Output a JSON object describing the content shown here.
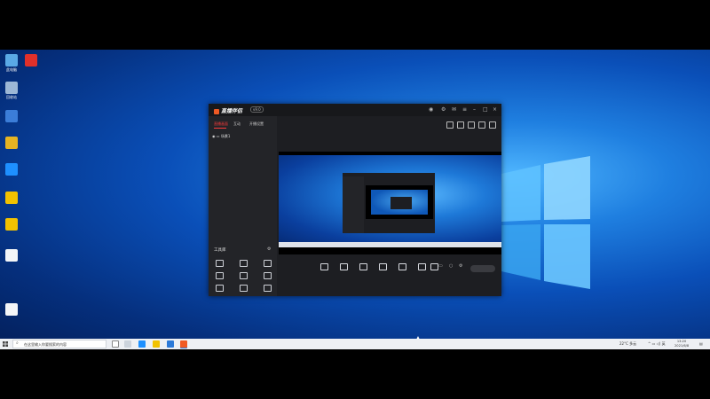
{
  "desktop": {
    "icons": [
      {
        "label": "此电脑",
        "color": "#5aa9e6"
      },
      {
        "label": "",
        "color": "#e0302a"
      },
      {
        "label": "回收站",
        "color": "#9db8d6"
      },
      {
        "label": "",
        "color": "#3b7dd8"
      },
      {
        "label": "",
        "color": "#e6b422"
      },
      {
        "label": "",
        "color": "#1e90ff"
      },
      {
        "label": "",
        "color": "#f2c200"
      },
      {
        "label": "",
        "color": "#f2c200"
      },
      {
        "label": "",
        "color": "#f4f6f8"
      },
      {
        "label": "",
        "color": "#f4f6f8"
      }
    ]
  },
  "app": {
    "brand": "直播伴侣",
    "version": "v9.0",
    "tabs": [
      "直播画面",
      "互动",
      "开播设置"
    ],
    "scene": "场景1",
    "tools_title": "工具库",
    "tools": [
      "",
      "",
      "",
      "",
      "",
      "",
      "",
      "",
      "",
      "",
      "",
      ""
    ],
    "notice": "",
    "stream_title": "",
    "live_badge": "",
    "warning": "",
    "tag1": "",
    "tag2": "",
    "meta": "",
    "controls": [
      "",
      "",
      "",
      "",
      "",
      "",
      ""
    ],
    "go_live": "",
    "status_items": [
      "",
      "",
      "",
      "",
      "",
      ""
    ]
  },
  "taskbar": {
    "search_placeholder": "在这里输入你要搜索的内容",
    "weather": "22°C 多云",
    "time": "13:20",
    "date": "2021/6/8"
  },
  "colors": {
    "accent": "#ff3b3b",
    "brand": "#f05a24"
  }
}
